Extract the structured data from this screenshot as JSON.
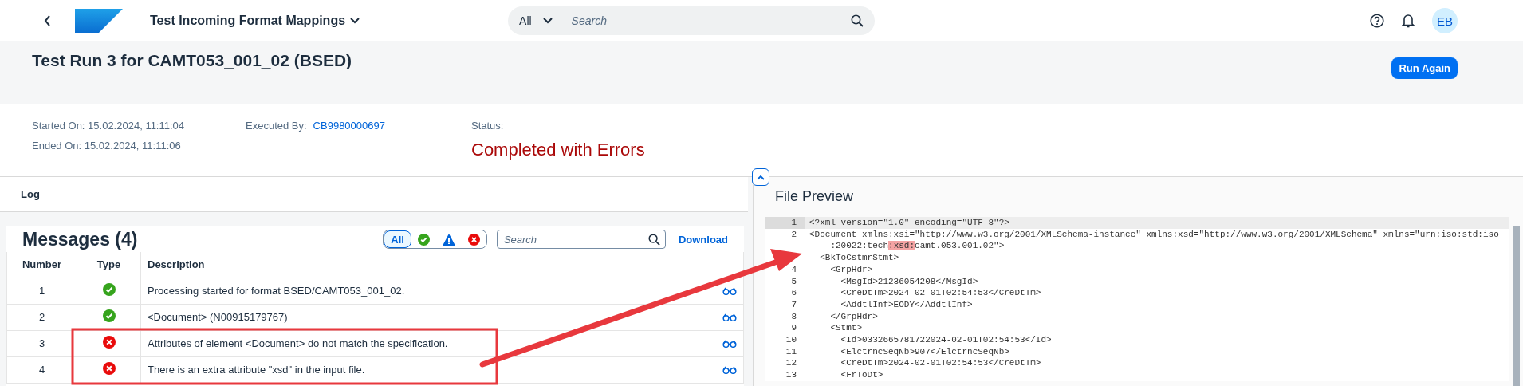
{
  "shell": {
    "app_title": "Test Incoming Format Mappings",
    "search": {
      "scope": "All",
      "placeholder": "Search"
    },
    "avatar": "EB"
  },
  "header": {
    "title": "Test Run 3 for CAMT053_001_02 (BSED)",
    "action": "Run Again"
  },
  "info": {
    "started": "Started On: 15.02.2024, 11:11:04",
    "ended": "Ended On: 15.02.2024, 11:11:06",
    "executed_label": "Executed By:",
    "executed_by": "CB9980000697",
    "status_label": "Status:",
    "status": "Completed with Errors"
  },
  "log": {
    "tab": "Log",
    "title": "Messages (4)",
    "filters": [
      {
        "kind": "all",
        "label": "All",
        "selected": true
      },
      {
        "kind": "success",
        "selected": false
      },
      {
        "kind": "warning",
        "selected": false
      },
      {
        "kind": "error",
        "selected": false
      }
    ],
    "search_placeholder": "Search",
    "download": "Download",
    "columns": [
      "Number",
      "Type",
      "Description"
    ],
    "rows": [
      {
        "number": "1",
        "kind": "success",
        "description": "Processing started for format BSED/CAMT053_001_02."
      },
      {
        "number": "2",
        "kind": "success",
        "description": "<Document> (N00915179767)"
      },
      {
        "number": "3",
        "kind": "error",
        "description": "Attributes of element <Document> do not match the specification."
      },
      {
        "number": "4",
        "kind": "error",
        "description": "There is an extra attribute \"xsd\" in the input file."
      }
    ]
  },
  "preview": {
    "title": "File Preview",
    "lines": [
      {
        "number": "1",
        "current": true,
        "rows": [
          [
            {
              "text": "<?xml version=\"1.0\" encoding=\"UTF-8\"?>",
              "highlighted": false
            }
          ]
        ]
      },
      {
        "number": "2",
        "current": false,
        "rows": [
          [
            {
              "text": "<Document xmlns:xsi=\"http://www.w3.org/2001/XMLSchema-instance\" xmlns:xsd=\"http://www.w3.org/2001/XMLSchema\" xmlns=\"urn:iso:std:iso",
              "highlighted": false
            }
          ],
          [
            {
              "text": "    :20022:tech",
              "highlighted": false
            },
            {
              "text": ":xsd:",
              "highlighted": true
            },
            {
              "text": "camt.053.001.02\">",
              "highlighted": false
            }
          ]
        ]
      },
      {
        "current": false,
        "rows": [
          [
            {
              "text": "  <BkToCstmrStmt>",
              "highlighted": false
            }
          ]
        ]
      },
      {
        "number": "4",
        "current": false,
        "rows": [
          [
            {
              "text": "    <GrpHdr>",
              "highlighted": false
            }
          ]
        ]
      },
      {
        "number": "5",
        "current": false,
        "rows": [
          [
            {
              "text": "      <MsgId>21236054208</MsgId>",
              "highlighted": false
            }
          ]
        ]
      },
      {
        "number": "6",
        "current": false,
        "rows": [
          [
            {
              "text": "      <CreDtTm>2024-02-01T02:54:53</CreDtTm>",
              "highlighted": false
            }
          ]
        ]
      },
      {
        "number": "7",
        "current": false,
        "rows": [
          [
            {
              "text": "      <AddtlInf>EODY</AddtlInf>",
              "highlighted": false
            }
          ]
        ]
      },
      {
        "number": "8",
        "current": false,
        "rows": [
          [
            {
              "text": "    </GrpHdr>",
              "highlighted": false
            }
          ]
        ]
      },
      {
        "number": "9",
        "current": false,
        "rows": [
          [
            {
              "text": "    <Stmt>",
              "highlighted": false
            }
          ]
        ]
      },
      {
        "number": "10",
        "current": false,
        "rows": [
          [
            {
              "text": "      <Id>0332665781722024-02-01T02:54:53</Id>",
              "highlighted": false
            }
          ]
        ]
      },
      {
        "number": "11",
        "current": false,
        "rows": [
          [
            {
              "text": "      <ElctrncSeqNb>907</ElctrncSeqNb>",
              "highlighted": false
            }
          ]
        ]
      },
      {
        "number": "12",
        "current": false,
        "rows": [
          [
            {
              "text": "      <CreDtTm>2024-02-01T02:54:53</CreDtTm>",
              "highlighted": false
            }
          ]
        ]
      },
      {
        "number": "13",
        "current": false,
        "rows": [
          [
            {
              "text": "      <FrToDt>",
              "highlighted": false
            }
          ]
        ]
      }
    ]
  }
}
